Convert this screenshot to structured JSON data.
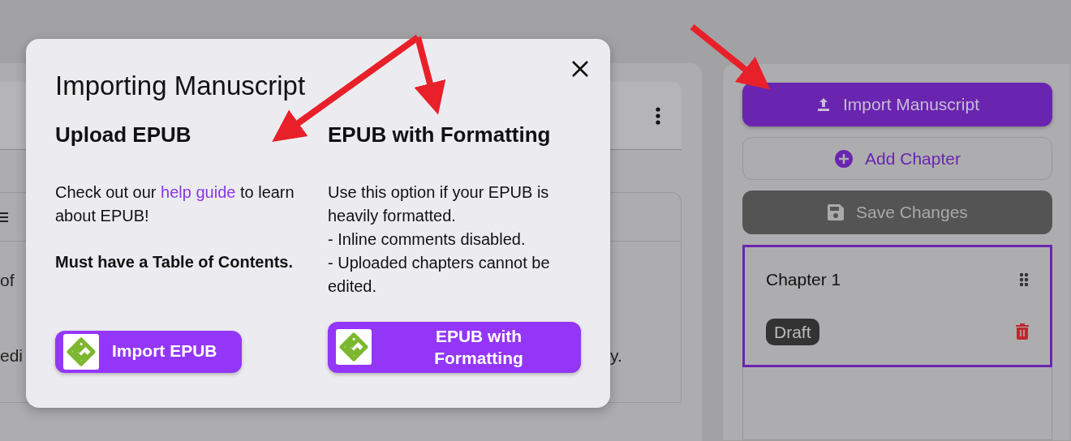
{
  "background_text": [
    "of",
    "edi",
    "y."
  ],
  "sidebar": {
    "buttons": [
      {
        "kind": "primary",
        "label": "Import Manuscript"
      },
      {
        "kind": "outline",
        "label": "Add Chapter"
      },
      {
        "kind": "dark",
        "label": "Save Changes"
      }
    ],
    "chapters": [
      {
        "title": "Chapter 1",
        "status": "Draft",
        "selected": true
      }
    ]
  },
  "modal": {
    "title": "Importing Manuscript",
    "options": [
      {
        "heading": "Upload EPUB",
        "body": [
          {
            "kind": "link_sentence",
            "before": "Check out our ",
            "link": "help guide",
            "after": " to learn about EPUB!"
          },
          {
            "kind": "bold",
            "text": "Must have a Table of Contents."
          }
        ],
        "button": "Import EPUB"
      },
      {
        "heading": "EPUB with Formatting",
        "body": [
          {
            "kind": "text",
            "text": "Use this option if your EPUB is heavily formatted."
          },
          {
            "kind": "text",
            "text": "- Inline comments disabled."
          },
          {
            "kind": "text",
            "text": "- Uploaded chapters cannot be edited."
          }
        ],
        "button": "EPUB with Formatting"
      }
    ]
  }
}
